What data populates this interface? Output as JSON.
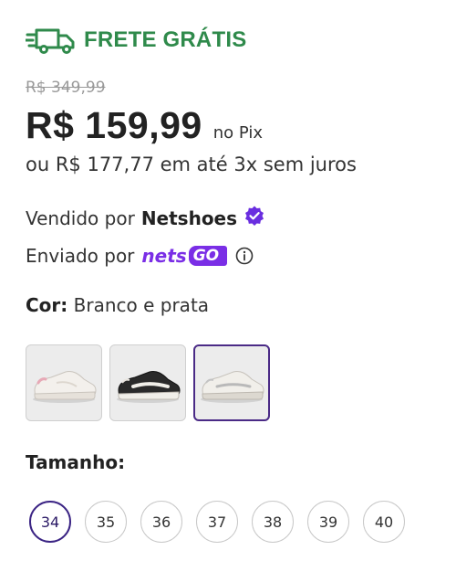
{
  "shipping": {
    "label": "FRETE GRÁTIS",
    "icon": "truck-icon"
  },
  "pricing": {
    "old_price": "R$ 349,99",
    "price": "R$ 159,99",
    "pix_label": "no Pix",
    "installments": "ou R$ 177,77 em até 3x sem juros"
  },
  "seller": {
    "prefix": "Vendido por",
    "name": "Netshoes",
    "verified_icon": "verified-badge-icon"
  },
  "shipped_by": {
    "prefix": "Enviado por",
    "brand_text": "nets",
    "brand_go": "GO",
    "info_icon": "info-icon"
  },
  "color": {
    "label": "Cor:",
    "value": "Branco e prata",
    "options": [
      {
        "name": "Branco e rosa",
        "selected": false
      },
      {
        "name": "Preto e branco",
        "selected": false
      },
      {
        "name": "Branco e prata",
        "selected": true
      }
    ]
  },
  "size": {
    "label": "Tamanho:",
    "options": [
      "34",
      "35",
      "36",
      "37",
      "38",
      "39",
      "40"
    ],
    "selected": "34"
  },
  "colors": {
    "shipping_green": "#2f8a4b",
    "brand_purple": "#7a2ee6",
    "selected_border": "#3b2484"
  }
}
